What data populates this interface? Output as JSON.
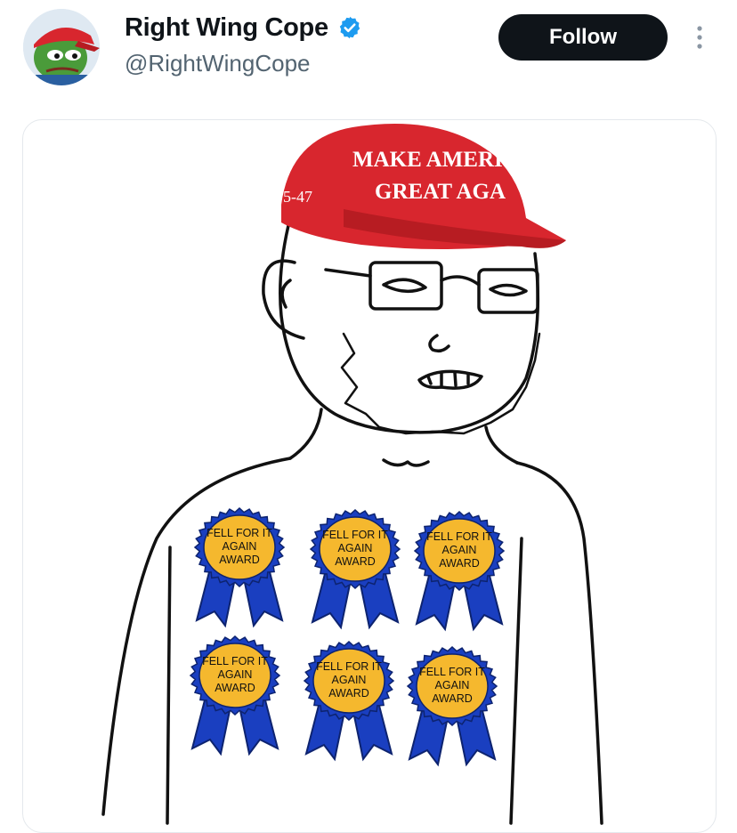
{
  "account": {
    "display_name": "Right Wing Cope",
    "handle": "@RightWingCope",
    "verified": true,
    "verified_color": "#1d9bf0"
  },
  "actions": {
    "follow_label": "Follow",
    "more_icon": "more-vertical-icon"
  },
  "meme": {
    "hat_line1": "MAKE AMERI",
    "hat_line2": "GREAT AGA",
    "hat_side": "5-47",
    "hat_color": "#d8262e",
    "award_color": "#f5b82e",
    "award_ribbon_color": "#1a3fc0",
    "awards": [
      {
        "line1": "FELL FOR IT",
        "line2": "AGAIN",
        "line3": "AWARD"
      },
      {
        "line1": "FELL FOR IT",
        "line2": "AGAIN",
        "line3": "AWARD"
      },
      {
        "line1": "FELL FOR IT",
        "line2": "AGAIN",
        "line3": "AWARD"
      },
      {
        "line1": "FELL FOR IT",
        "line2": "AGAIN",
        "line3": "AWARD"
      },
      {
        "line1": "FELL FOR IT",
        "line2": "AGAIN",
        "line3": "AWARD"
      },
      {
        "line1": "FELL FOR IT",
        "line2": "AGAIN",
        "line3": "AWARD"
      }
    ]
  }
}
